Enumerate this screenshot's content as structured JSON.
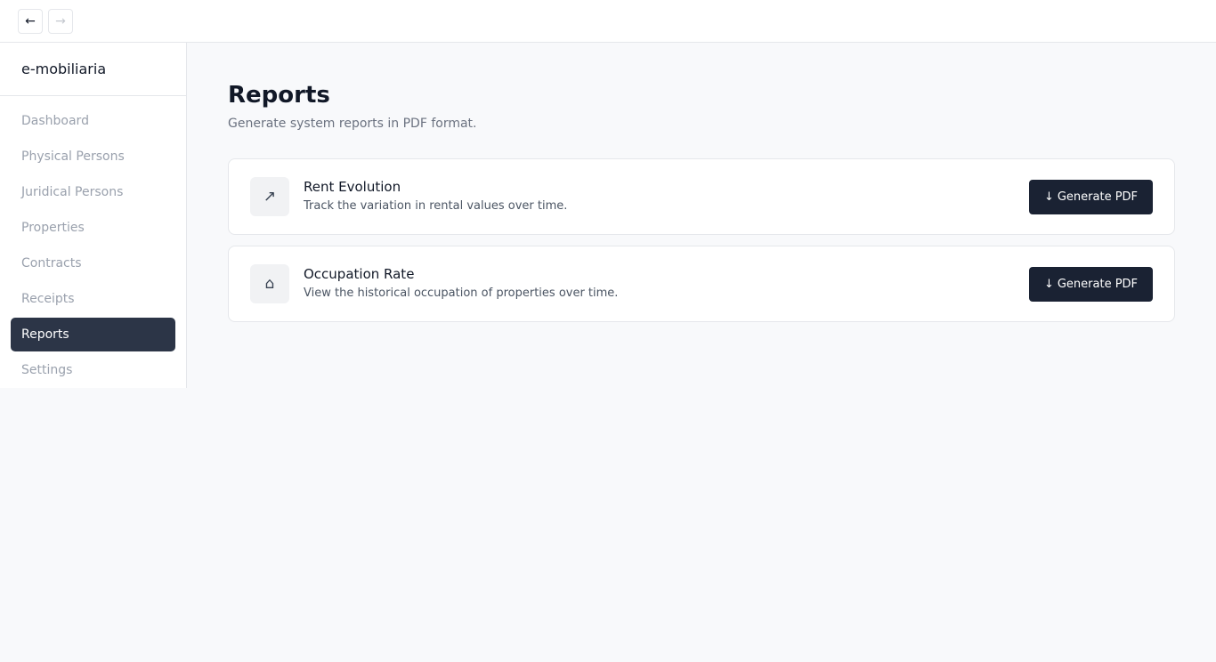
{
  "topbar": {
    "back_icon": "←",
    "forward_icon": "→"
  },
  "sidebar": {
    "brand": "e-mobiliaria",
    "items": [
      {
        "label": "Dashboard"
      },
      {
        "label": "Physical Persons"
      },
      {
        "label": "Juridical Persons"
      },
      {
        "label": "Properties"
      },
      {
        "label": "Contracts"
      },
      {
        "label": "Receipts"
      },
      {
        "label": "Reports",
        "active": true
      },
      {
        "label": "Settings"
      }
    ]
  },
  "main": {
    "title": "Reports",
    "subtitle": "Generate system reports in PDF format.",
    "reports": [
      {
        "icon": "↗",
        "icon_name": "trend-up-icon",
        "title": "Rent Evolution",
        "description": "Track the variation in rental values over time.",
        "button_icon": "↓",
        "button_label": "Generate PDF"
      },
      {
        "icon": "⌂",
        "icon_name": "home-icon",
        "title": "Occupation Rate",
        "description": "View the historical occupation of properties over time.",
        "button_icon": "↓",
        "button_label": "Generate PDF"
      }
    ]
  },
  "colors": {
    "active_nav_bg": "#2c3547",
    "button_bg": "#1a2233",
    "page_bg": "#f8f9fb"
  }
}
